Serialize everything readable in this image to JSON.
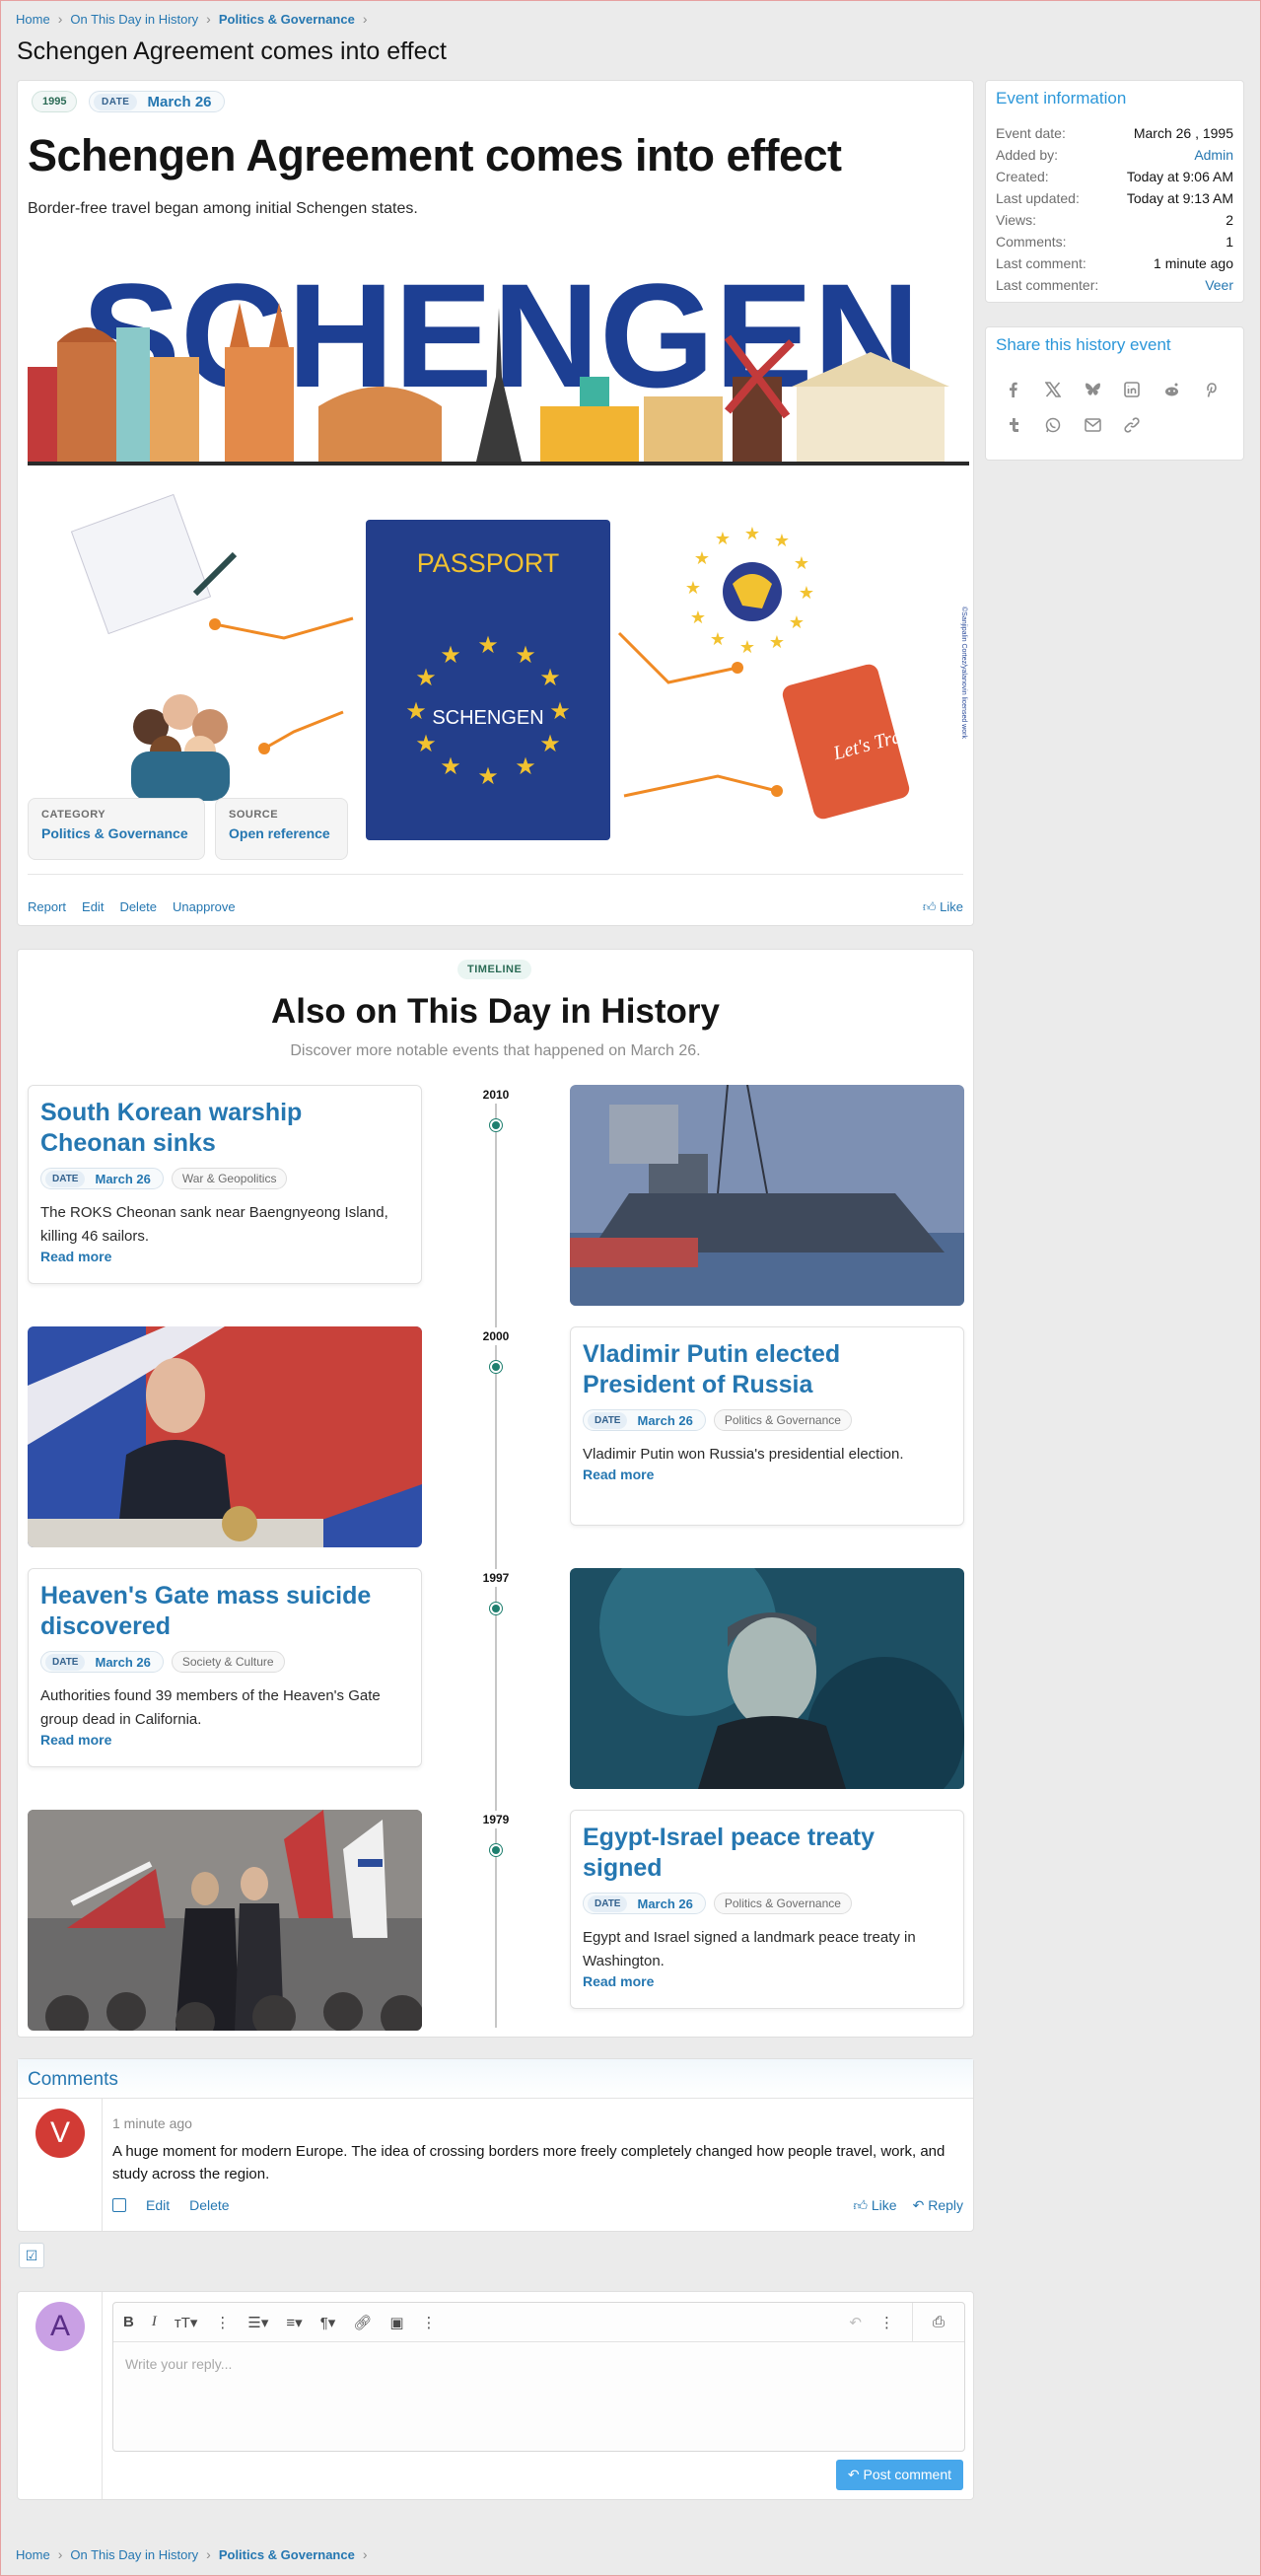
{
  "breadcrumbs": [
    {
      "label": "Home"
    },
    {
      "label": "On This Day in History"
    },
    {
      "label": "Politics & Governance"
    }
  ],
  "page_title": "Schengen Agreement comes into effect",
  "event": {
    "year": "1995",
    "date_tag": "DATE",
    "date": "March 26",
    "title": "Schengen Agreement comes into effect",
    "description": "Border-free travel began among initial Schengen states.",
    "hero": {
      "headline": "SCHENGEN",
      "passport_title": "PASSPORT",
      "passport_label": "SCHENGEN",
      "sticker_text": "Let's Travel",
      "credit": "©Sanjipalin Cortez/yalanovin licensed work"
    },
    "category_label": "CATEGORY",
    "category_value": "Politics & Governance",
    "source_label": "SOURCE",
    "source_value": "Open reference",
    "actions": [
      "Report",
      "Edit",
      "Delete",
      "Unapprove"
    ],
    "like_label": "Like"
  },
  "info": {
    "title": "Event information",
    "rows": [
      {
        "k": "Event date:",
        "v": "March 26 , 1995",
        "link": false
      },
      {
        "k": "Added by:",
        "v": "Admin",
        "link": true
      },
      {
        "k": "Created:",
        "v": "Today at 9:06 AM",
        "link": false
      },
      {
        "k": "Last updated:",
        "v": "Today at 9:13 AM",
        "link": false
      },
      {
        "k": "Views:",
        "v": "2",
        "link": false
      },
      {
        "k": "Comments:",
        "v": "1",
        "link": false
      },
      {
        "k": "Last comment:",
        "v": "1 minute ago",
        "link": false
      },
      {
        "k": "Last commenter:",
        "v": "Veer",
        "link": true
      }
    ]
  },
  "share": {
    "title": "Share this history event",
    "icons": [
      "facebook-icon",
      "x-icon",
      "bluesky-icon",
      "linkedin-icon",
      "reddit-icon",
      "pinterest-icon",
      "tumblr-icon",
      "whatsapp-icon",
      "email-icon",
      "link-icon"
    ]
  },
  "timeline": {
    "chip": "TIMELINE",
    "title": "Also on This Day in History",
    "subtitle": "Discover more notable events that happened on March 26.",
    "items": [
      {
        "year": "2010",
        "title": "South Korean warship Cheonan sinks",
        "date_tag": "DATE",
        "date": "March 26",
        "category": "War & Geopolitics",
        "desc": "The ROKS Cheonan sank near Baengnyeong Island, killing 46 sailors.",
        "more": "Read more"
      },
      {
        "year": "2000",
        "title": "Vladimir Putin elected President of Russia",
        "date_tag": "DATE",
        "date": "March 26",
        "category": "Politics & Governance",
        "desc": "Vladimir Putin won Russia's presidential election.",
        "more": "Read more"
      },
      {
        "year": "1997",
        "title": "Heaven's Gate mass suicide discovered",
        "date_tag": "DATE",
        "date": "March 26",
        "category": "Society & Culture",
        "desc": "Authorities found 39 members of the Heaven's Gate group dead in California.",
        "more": "Read more"
      },
      {
        "year": "1979",
        "title": "Egypt-Israel peace treaty signed",
        "date_tag": "DATE",
        "date": "March 26",
        "category": "Politics & Governance",
        "desc": "Egypt and Israel signed a landmark peace treaty in Washington.",
        "more": "Read more"
      }
    ]
  },
  "comments": {
    "title": "Comments",
    "items": [
      {
        "avatar_letter": "V",
        "avatar_color": "#d23b35",
        "time": "1 minute ago",
        "text": "A huge moment for modern Europe. The idea of crossing borders more freely completely changed how people travel, work, and study across the region.",
        "edit": "Edit",
        "delete": "Delete",
        "like": "Like",
        "reply": "Reply"
      }
    ]
  },
  "reply": {
    "avatar_letter": "A",
    "avatar_color": "#c9a0e4",
    "placeholder": "Write your reply...",
    "submit": "Post comment"
  },
  "colors": {
    "link": "#2577b1",
    "accent": "#2c97d9",
    "timeline_dot": "#1f7f6f",
    "button": "#47a7eb"
  }
}
